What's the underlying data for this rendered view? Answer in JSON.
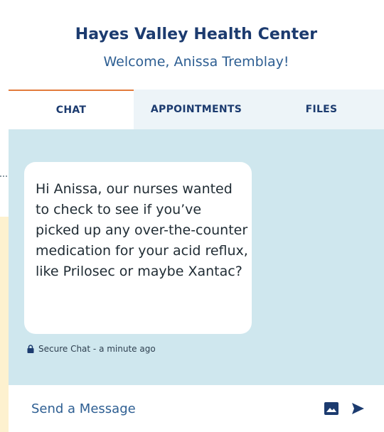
{
  "header": {
    "clinic_name": "Hayes Valley Health Center",
    "welcome": "Welcome, Anissa Tremblay!"
  },
  "tabs": [
    {
      "label": "CHAT",
      "active": true
    },
    {
      "label": "APPOINTMENTS",
      "active": false
    },
    {
      "label": "FILES",
      "active": false
    }
  ],
  "chat": {
    "message": "Hi Anissa, our nurses wanted to check to see if you’ve picked up any over-the-counter medication for your acid reflux, like Prilosec or maybe Xantac?",
    "meta": "Secure Chat - a minute ago",
    "meta_icon": "lock-icon"
  },
  "composer": {
    "placeholder": "Send a Message",
    "image_icon": "image-icon",
    "send_icon": "send-icon"
  },
  "colors": {
    "brand_navy": "#1c3b6f",
    "accent_orange": "#e27b3c",
    "chat_background": "#cfe7ee",
    "tab_inactive_background": "#edf4f8"
  }
}
